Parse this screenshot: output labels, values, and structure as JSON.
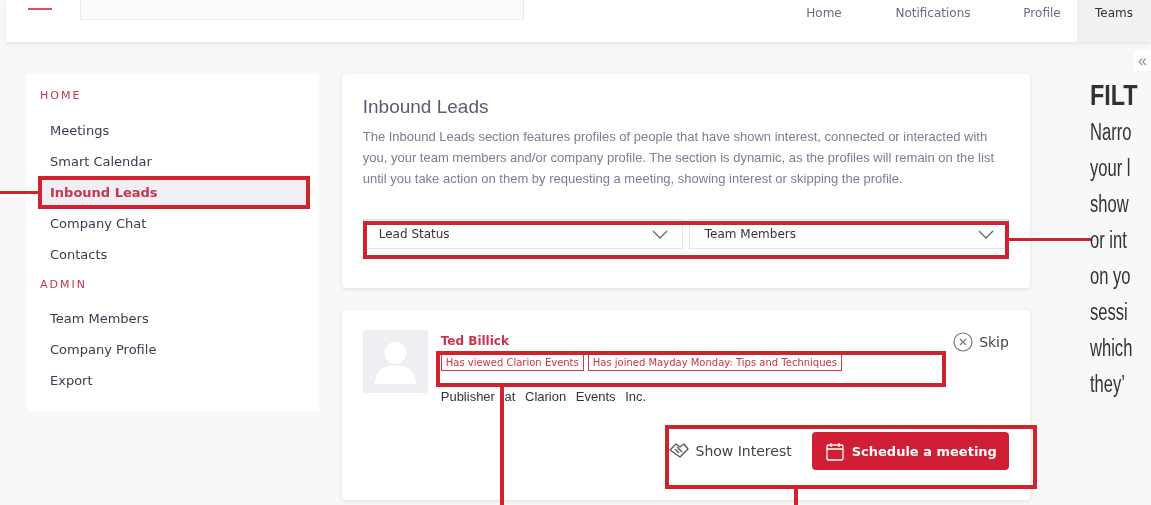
{
  "nav": [
    {
      "label": "Home",
      "selected": false
    },
    {
      "label": "Notifications",
      "selected": false
    },
    {
      "label": "Profile",
      "selected": false
    },
    {
      "label": "Teams",
      "selected": true
    }
  ],
  "sidebar": {
    "sections": [
      {
        "heading": "HOME",
        "items": [
          {
            "label": "Meetings",
            "selected": false
          },
          {
            "label": "Smart Calendar",
            "selected": false
          },
          {
            "label": "Inbound Leads",
            "selected": true
          },
          {
            "label": "Company Chat",
            "selected": false
          },
          {
            "label": "Contacts",
            "selected": false
          }
        ]
      },
      {
        "heading": "ADMIN",
        "items": [
          {
            "label": "Team Members",
            "selected": false
          },
          {
            "label": "Company Profile",
            "selected": false
          },
          {
            "label": "Export",
            "selected": false
          }
        ]
      }
    ]
  },
  "intro": {
    "title": "Inbound Leads",
    "description": "The Inbound Leads section features profiles of people that have shown interest, connected or interacted with you, your team members and/or company profile. The section is dynamic, as the profiles will remain on the list until you take action on them by requesting a meeting, showing interest or skipping the profile.",
    "filters": [
      "Lead Status",
      "Team Members"
    ]
  },
  "lead": {
    "name": "Ted Billick",
    "tags": [
      "Has viewed Clarion Events",
      "Has joined Mayday Monday: Tips and Techniques"
    ],
    "position": "Publisher at Clarion Events Inc.",
    "skip": "Skip",
    "show_interest": "Show Interest",
    "schedule": "Schedule a meeting"
  },
  "collapse_button": "«",
  "callout": {
    "title": "FILT",
    "lines": [
      "Narro",
      "your l",
      "show",
      "or int",
      "on yo",
      "sessi",
      "which",
      "they’"
    ]
  }
}
